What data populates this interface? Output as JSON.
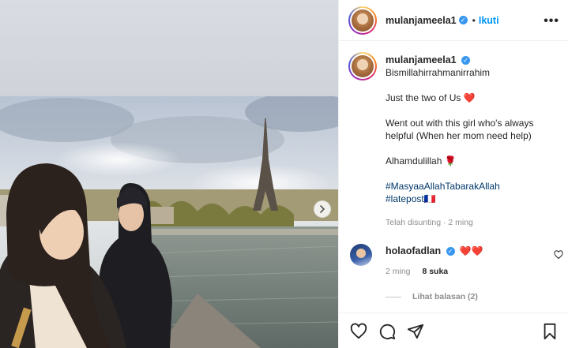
{
  "post": {
    "username": "mulanjameela1",
    "follow_label": "Ikuti",
    "separator": "•",
    "more_label": "•••",
    "verified_glyph": "✓",
    "caption_lines": [
      "Bismillahirrahmanirrahim",
      "Just the two of Us ❤️",
      "Went out with this girl who's always helpful (When her mom need help)",
      "Alhamdulillah 🌹"
    ],
    "hashtags": [
      "#MasyaaAllahTabarakAllah",
      "#latepost🇫🇷"
    ],
    "meta": "Telah disunting · 2 ming"
  },
  "comment": {
    "username": "holaofadlan",
    "text": "❤️❤️",
    "age": "2 ming",
    "likes": "8 suka",
    "view_replies": "Lihat balasan (2)"
  },
  "icons": {
    "next": "chevron-right-icon",
    "like": "heart-icon",
    "comment": "comment-icon",
    "share": "paper-plane-icon",
    "save": "bookmark-icon",
    "verified": "verified-badge-icon",
    "more": "more-options-icon"
  },
  "colors": {
    "link_blue": "#0095f6",
    "hashtag": "#00376b",
    "verified": "#3897f0",
    "muted": "#8e8e8e",
    "heart_red": "#e0245e"
  }
}
